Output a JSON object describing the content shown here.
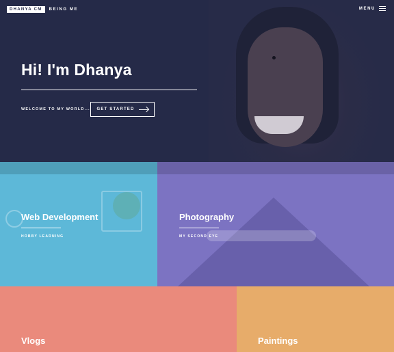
{
  "header": {
    "brand": "DHANYA CM",
    "tagline": "BEING ME",
    "menu_label": "MENU"
  },
  "hero": {
    "title": "Hi! I'm Dhanya",
    "welcome": "WELCOME TO MY WORLD...",
    "cta_label": "GET STARTED"
  },
  "tiles": [
    {
      "title": "Web Development",
      "subtitle": "HOBBY LEARNING",
      "color": "#5db8d8"
    },
    {
      "title": "Photography",
      "subtitle": "MY SECOND EYE",
      "color": "#7c73c2"
    },
    {
      "title": "Vlogs",
      "subtitle": "",
      "color": "#ea8a7c"
    },
    {
      "title": "Paintings",
      "subtitle": "",
      "color": "#e7ac6a"
    }
  ],
  "colors": {
    "hero_bg": "#252a48",
    "text": "#ffffff"
  },
  "icons": {
    "menu": "hamburger-icon",
    "cta": "arrow-right-icon"
  }
}
